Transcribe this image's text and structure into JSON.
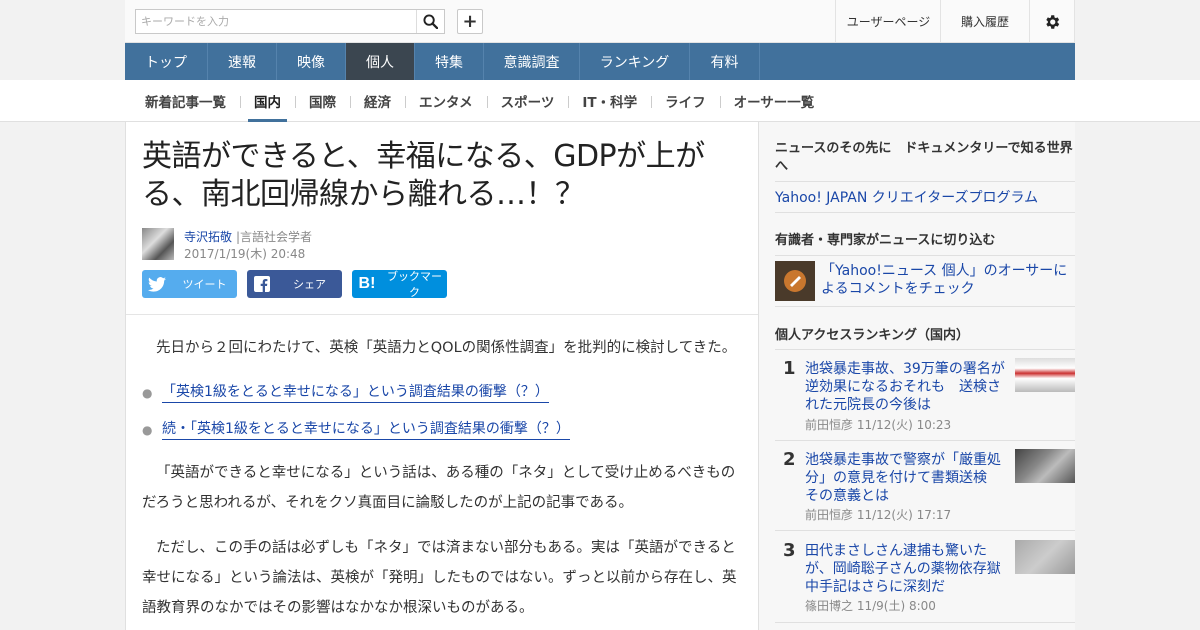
{
  "topbar": {
    "search_placeholder": "キーワードを入力",
    "user_page": "ユーザーページ",
    "purchase_history": "購入履歴"
  },
  "mainnav": [
    "トップ",
    "速報",
    "映像",
    "個人",
    "特集",
    "意識調査",
    "ランキング",
    "有料"
  ],
  "subnav": [
    "新着記事一覧",
    "国内",
    "国際",
    "経済",
    "エンタメ",
    "スポーツ",
    "IT・科学",
    "ライフ",
    "オーサー一覧"
  ],
  "article": {
    "title": "英語ができると、幸福になる、GDPが上がる、南北回帰線から離れる…！？",
    "author": "寺沢拓敬",
    "role": "|言語社会学者",
    "date": "2017/1/19(木) 20:48",
    "share": {
      "tweet": "ツイート",
      "facebook": "シェア",
      "hatena": "ブックマーク"
    },
    "p1": "先日から２回にわたけて、英検「英語力とQOLの関係性調査」を批判的に検討してきた。",
    "links": [
      "「英検1級をとると幸せになる」という調査結果の衝撃（？）",
      "続・「英検1級をとると幸せになる」という調査結果の衝撃（？）"
    ],
    "p2": "「英語ができると幸せになる」という話は、ある種の「ネタ」として受け止めるべきものだろうと思われるが、それをクソ真面目に論駁したのが上記の記事である。",
    "p3": "ただし、この手の話は必ずしも「ネタ」では済まない部分もある。実は「英語ができると幸せになる」という論法は、英検が「発明」したものではない。ずっと以前から存在し、英語教育界のなかではその影響はなかなか根深いものがある。"
  },
  "sidebar": {
    "promo_heading": "ニュースのその先に　ドキュメンタリーで知る世界へ",
    "promo_link": "Yahoo! JAPAN クリエイターズプログラム",
    "expert_heading": "有識者・専門家がニュースに切り込む",
    "expert_link": "「Yahoo!ニュース 個人」のオーサーによるコメントをチェック",
    "ranking_heading": "個人アクセスランキング（国内）",
    "ranking": [
      {
        "num": "1",
        "title": "池袋暴走事故、39万筆の署名が逆効果になるおそれも　送検された元院長の今後は",
        "meta": "前田恒彦 11/12(火) 10:23"
      },
      {
        "num": "2",
        "title": "池袋暴走事故で警察が「厳重処分」の意見を付けて書類送検 その意義とは",
        "meta": "前田恒彦 11/12(火) 17:17"
      },
      {
        "num": "3",
        "title": "田代まさしさん逮捕も驚いたが、岡崎聡子さんの薬物依存獄中手記はさらに深刻だ",
        "meta": "篠田博之 11/9(土) 8:00"
      }
    ]
  },
  "colors": {
    "nav": "#41719c",
    "nav_active": "#3b4650",
    "link": "#1a47a8",
    "twitter": "#55acee",
    "facebook": "#3b5998",
    "hatena": "#008fde"
  }
}
